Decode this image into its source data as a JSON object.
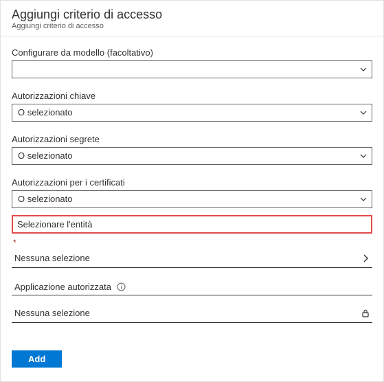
{
  "header": {
    "title": "Aggiungi criterio di accesso",
    "subtitle": "Aggiungi criterio di accesso"
  },
  "template": {
    "label": "Configurare da modello (facoltativo)",
    "value": ""
  },
  "key_permissions": {
    "label": "Autorizzazioni chiave",
    "value": "O selezionato"
  },
  "secret_permissions": {
    "label": "Autorizzazioni segrete",
    "value": "O selezionato"
  },
  "cert_permissions": {
    "label": "Autorizzazioni per i certificati",
    "value": "O selezionato"
  },
  "principal": {
    "heading": "Selezionare l'entità",
    "required_mark": "*",
    "value": "Nessuna selezione"
  },
  "authorized_app": {
    "label": "Applicazione autorizzata",
    "value": "Nessuna selezione"
  },
  "actions": {
    "add": "Add"
  }
}
